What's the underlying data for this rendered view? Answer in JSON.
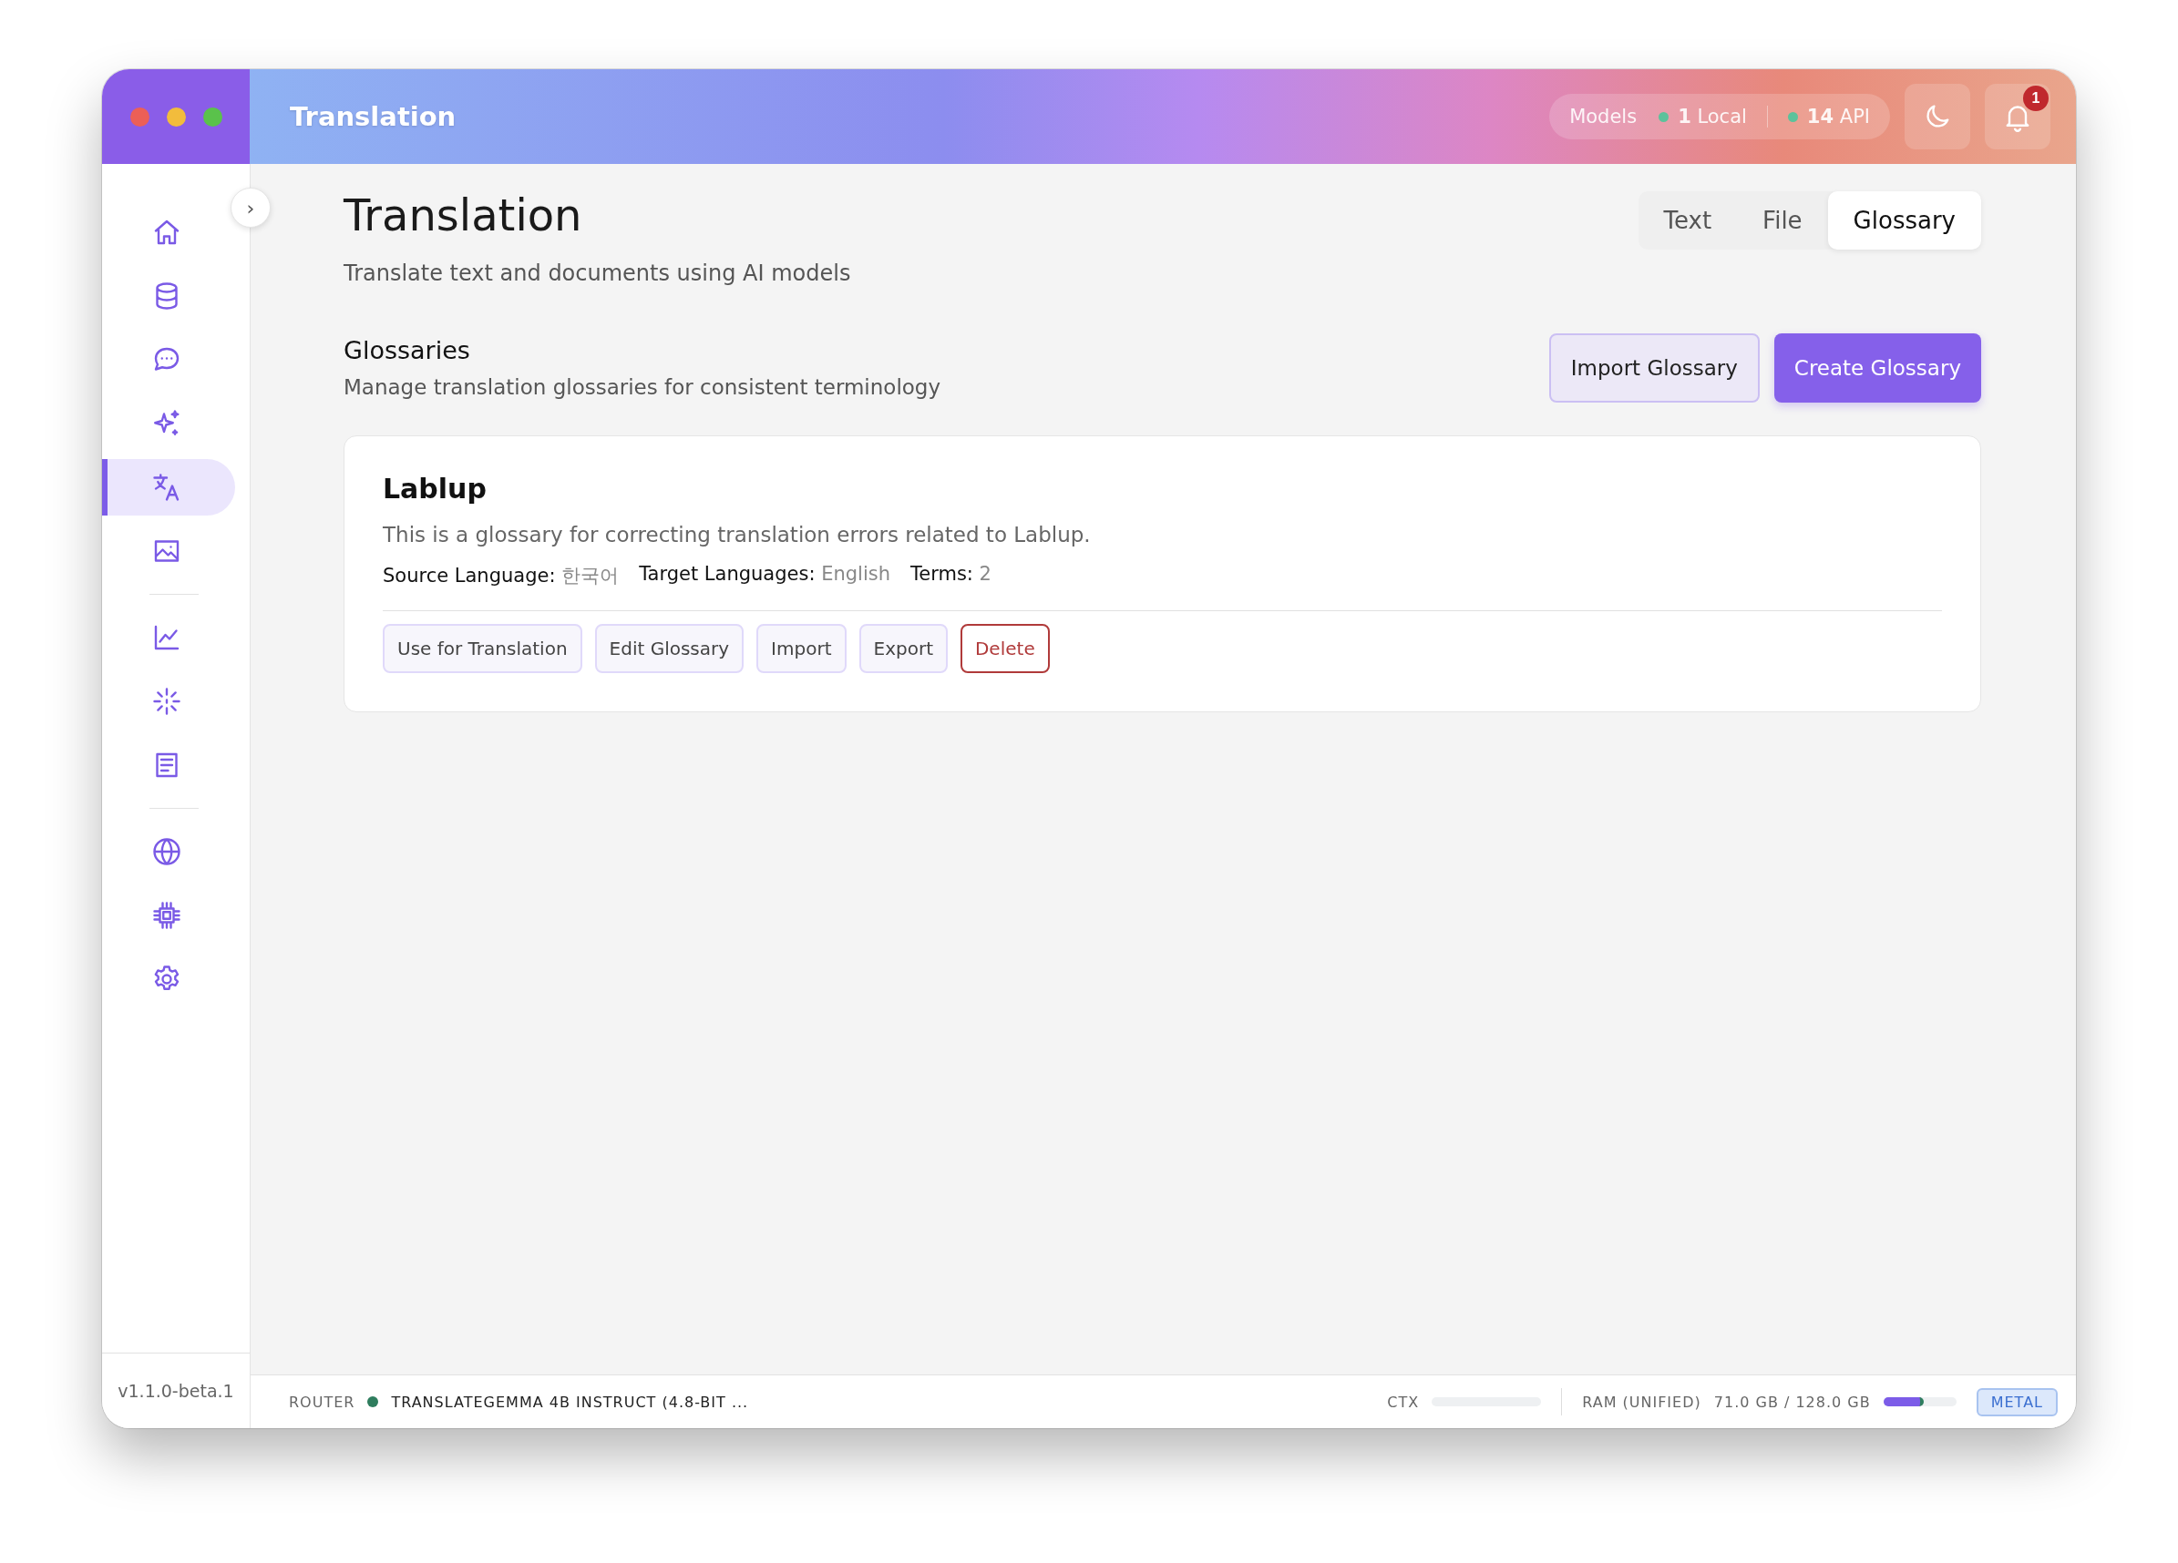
{
  "window": {
    "title": "Translation"
  },
  "header": {
    "models_label": "Models",
    "models": [
      {
        "count": "1",
        "label": "Local",
        "color": "#5cc29b"
      },
      {
        "count": "14",
        "label": "API",
        "color": "#5cc29b"
      }
    ],
    "notification_count": "1"
  },
  "sidebar": {
    "toggle": "›",
    "groups": [
      [
        {
          "selected": false
        },
        {
          "selected": false
        },
        {
          "selected": false
        },
        {
          "selected": false
        },
        {
          "selected": true
        },
        {
          "selected": false
        }
      ],
      [
        {
          "selected": false
        },
        {
          "selected": false
        },
        {
          "selected": false
        }
      ],
      [
        {
          "selected": false
        },
        {
          "selected": false
        },
        {
          "selected": false
        }
      ]
    ],
    "version": "v1.1.0-beta.1"
  },
  "page": {
    "title": "Translation",
    "subtitle": "Translate text and documents using AI models",
    "tabs": [
      {
        "label": "Text",
        "selected": false
      },
      {
        "label": "File",
        "selected": false
      },
      {
        "label": "Glossary",
        "selected": true
      }
    ]
  },
  "section": {
    "title": "Glossaries",
    "description": "Manage translation glossaries for consistent terminology",
    "buttons": [
      {
        "label": "Import Glossary",
        "kind": "secondary"
      },
      {
        "label": "Create Glossary",
        "kind": "primary"
      }
    ]
  },
  "glossaries": [
    {
      "name": "Lablup",
      "description": "This is a glossary for correcting translation errors related to Lablup.",
      "meta": [
        {
          "label": "Source Language:",
          "value": "한국어"
        },
        {
          "label": "Target Languages:",
          "value": "English"
        },
        {
          "label": "Terms:",
          "value": "2"
        }
      ],
      "actions": [
        {
          "label": "Use for Translation",
          "kind": "normal"
        },
        {
          "label": "Edit Glossary",
          "kind": "normal"
        },
        {
          "label": "Import",
          "kind": "normal"
        },
        {
          "label": "Export",
          "kind": "normal"
        },
        {
          "label": "Delete",
          "kind": "danger"
        }
      ]
    }
  ],
  "status_bar": {
    "router_label": "ROUTER",
    "model": "TRANSLATEGEMMA 4B INSTRUCT (4.8-BIT ...",
    "ctx_label": "CTX",
    "ctx": {
      "level": 0
    },
    "ram_label": "RAM (UNIFIED)",
    "ram_value": "71.0 GB / 128.0 GB",
    "ram": {
      "level": 0.55
    },
    "backend": "METAL"
  }
}
